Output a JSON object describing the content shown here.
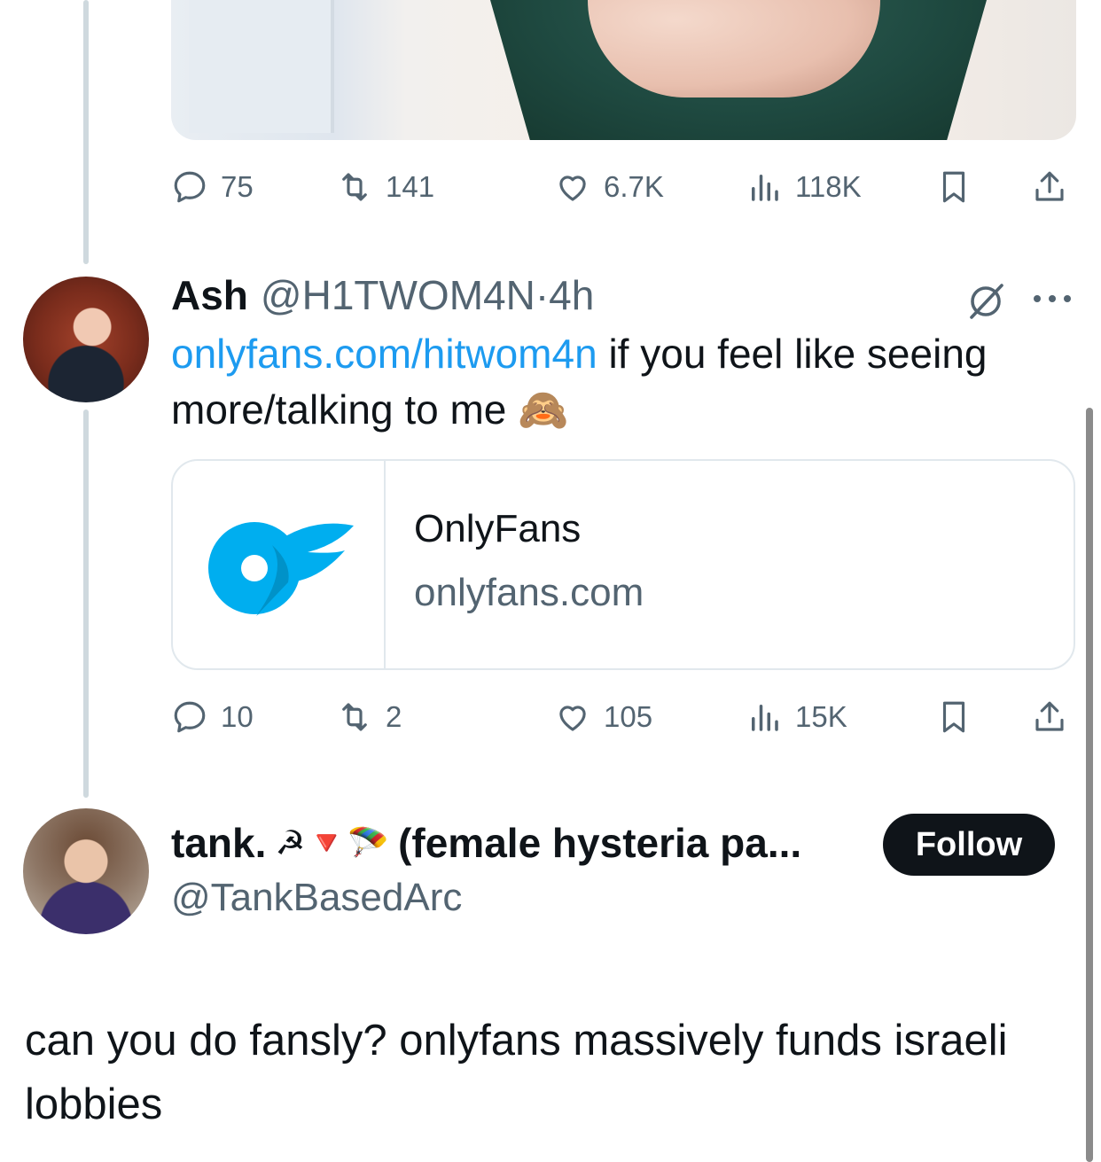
{
  "tweet1": {
    "stats": {
      "replies": "75",
      "retweets": "141",
      "likes": "6.7K",
      "views": "118K"
    }
  },
  "tweet2": {
    "name": "Ash",
    "handle": "@H1TWOM4N",
    "separator": " · ",
    "time": "4h",
    "text_link": "onlyfans.com/hitwom4n",
    "text_rest": " if you feel like seeing more/talking to me ",
    "emoji": "🙈",
    "card": {
      "title": "OnlyFans",
      "domain": "onlyfans.com"
    },
    "stats": {
      "replies": "10",
      "retweets": "2",
      "likes": "105",
      "views": "15K"
    }
  },
  "tweet3": {
    "name": "tank.",
    "name_emojis": "☭🔻🪂",
    "name_suffix": "(female hysteria pa...",
    "handle": "@TankBasedArc",
    "follow_label": "Follow",
    "text": "can you do fansly? onlyfans massively funds israeli lobbies"
  },
  "colors": {
    "link": "#1d9bf0",
    "muted": "#536471",
    "text": "#0f1419",
    "onlyfans_blue": "#00aeef"
  },
  "icons": [
    "reply-icon",
    "retweet-icon",
    "like-icon",
    "views-icon",
    "bookmark-icon",
    "share-icon",
    "grok-icon",
    "more-icon"
  ]
}
